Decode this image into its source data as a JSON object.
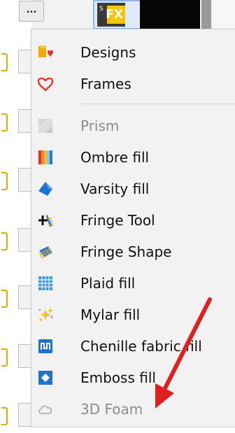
{
  "toolbar": {
    "more_label": "..."
  },
  "thumbnail": {
    "corner_label": "S",
    "fx_label": "FX"
  },
  "menu": {
    "items": [
      {
        "label": "Designs",
        "icon": "designs-icon",
        "enabled": true
      },
      {
        "label": "Frames",
        "icon": "frames-icon",
        "enabled": true
      },
      {
        "label": "Prism",
        "icon": "prism-icon",
        "enabled": false
      },
      {
        "label": "Ombre fill",
        "icon": "ombre-fill-icon",
        "enabled": true
      },
      {
        "label": "Varsity fill",
        "icon": "varsity-fill-icon",
        "enabled": true
      },
      {
        "label": "Fringe Tool",
        "icon": "fringe-tool-icon",
        "enabled": true
      },
      {
        "label": "Fringe Shape",
        "icon": "fringe-shape-icon",
        "enabled": true
      },
      {
        "label": "Plaid fill",
        "icon": "plaid-fill-icon",
        "enabled": true
      },
      {
        "label": "Mylar fill",
        "icon": "mylar-fill-icon",
        "enabled": true
      },
      {
        "label": "Chenille fabric fill",
        "icon": "chenille-fabric-fill-icon",
        "enabled": true
      },
      {
        "label": "Emboss fill",
        "icon": "emboss-fill-icon",
        "enabled": true
      },
      {
        "label": "3D Foam",
        "icon": "3d-foam-icon",
        "enabled": false
      }
    ]
  },
  "annotation": {
    "color": "#e02020",
    "icon": "red-arrow-icon"
  },
  "colors": {
    "menu_background": "#f2f2f2",
    "text": "#111111",
    "disabled_text": "#8c8c8c",
    "row_marker": "#e8a800",
    "accent_blue": "#1e73d0"
  }
}
